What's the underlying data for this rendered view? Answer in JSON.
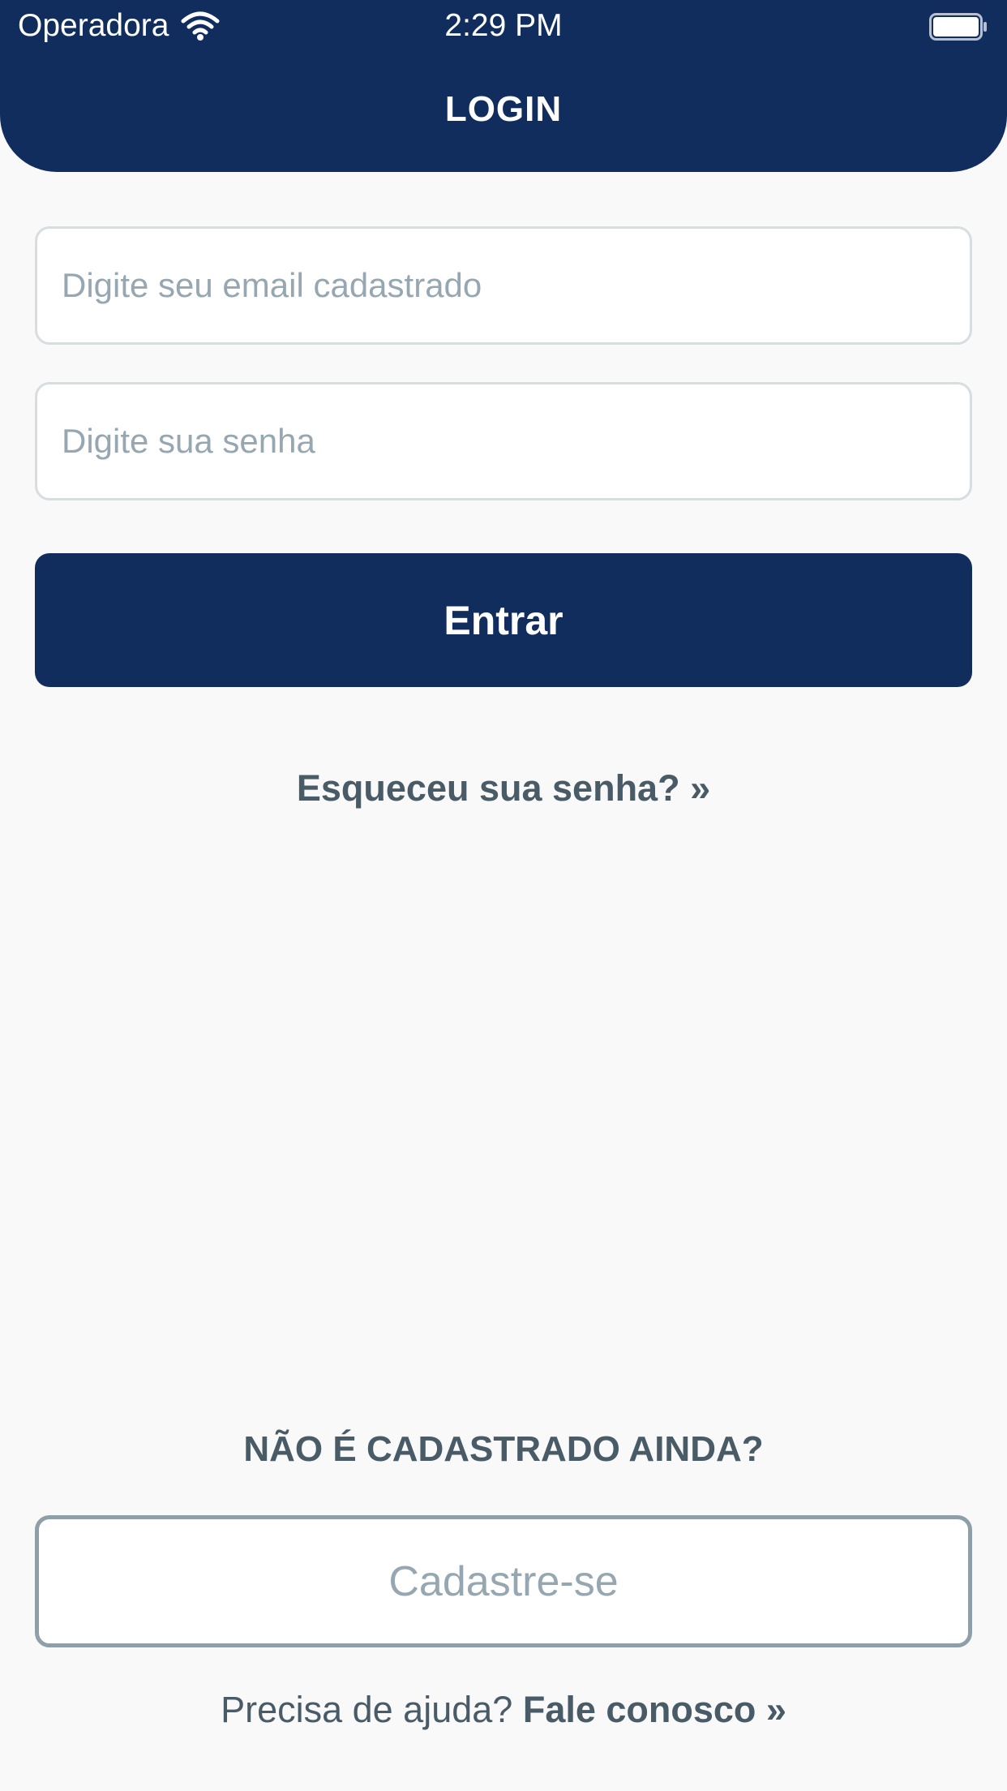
{
  "status_bar": {
    "carrier": "Operadora",
    "time": "2:29 PM",
    "wifi_icon": "wifi-icon",
    "battery_icon": "battery-full-icon"
  },
  "header": {
    "title": "LOGIN"
  },
  "form": {
    "email_placeholder": "Digite seu email cadastrado",
    "email_value": "",
    "password_placeholder": "Digite sua senha",
    "password_value": "",
    "login_label": "Entrar",
    "forgot_label": "Esqueceu sua senha? »"
  },
  "signup": {
    "question": "NÃO É CADASTRADO AINDA?",
    "button_label": "Cadastre-se"
  },
  "help": {
    "text": "Precisa de ajuda?",
    "link_label": "Fale conosco »"
  },
  "colors": {
    "primary": "#112d5e",
    "background": "#f9f9f9",
    "text": "#495b66",
    "muted": "#96a7b1"
  }
}
